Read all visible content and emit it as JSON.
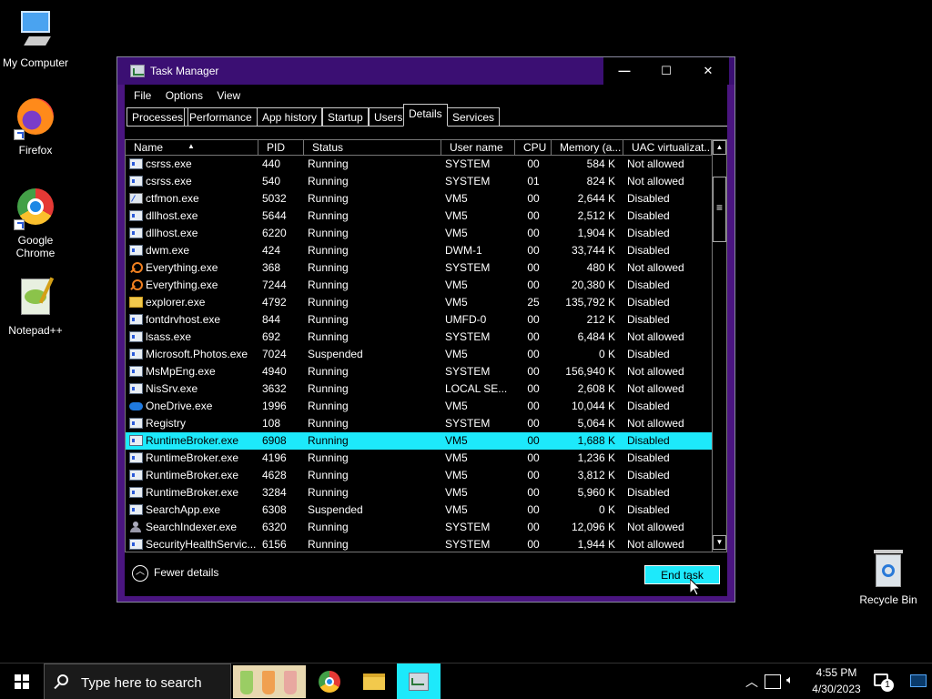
{
  "desktop": {
    "icons": [
      {
        "label": "My Computer"
      },
      {
        "label": "Firefox"
      },
      {
        "label": "Google Chrome"
      },
      {
        "label": "Notepad++"
      }
    ],
    "recycle_bin": "Recycle Bin"
  },
  "window": {
    "title": "Task Manager",
    "controls": {
      "minimize": "—",
      "maximize": "☐",
      "close": "✕"
    },
    "menu": [
      "File",
      "Options",
      "View"
    ],
    "tabs": [
      "Processes",
      "Performance",
      "App history",
      "Startup",
      "Users",
      "Details",
      "Services"
    ],
    "active_tab": "Details",
    "columns": {
      "name": "Name",
      "pid": "PID",
      "status": "Status",
      "user": "User name",
      "cpu": "CPU",
      "memory": "Memory (a...",
      "uac": "UAC virtualizat..."
    },
    "rows": [
      {
        "icon": "process-icon",
        "name": "csrss.exe",
        "pid": "440",
        "status": "Running",
        "user": "SYSTEM",
        "cpu": "00",
        "memory": "584 K",
        "uac": "Not allowed"
      },
      {
        "icon": "process-icon",
        "name": "csrss.exe",
        "pid": "540",
        "status": "Running",
        "user": "SYSTEM",
        "cpu": "01",
        "memory": "824 K",
        "uac": "Not allowed"
      },
      {
        "icon": "notepad-icon",
        "name": "ctfmon.exe",
        "pid": "5032",
        "status": "Running",
        "user": "VM5",
        "cpu": "00",
        "memory": "2,644 K",
        "uac": "Disabled"
      },
      {
        "icon": "process-icon",
        "name": "dllhost.exe",
        "pid": "5644",
        "status": "Running",
        "user": "VM5",
        "cpu": "00",
        "memory": "2,512 K",
        "uac": "Disabled"
      },
      {
        "icon": "process-icon",
        "name": "dllhost.exe",
        "pid": "6220",
        "status": "Running",
        "user": "VM5",
        "cpu": "00",
        "memory": "1,904 K",
        "uac": "Disabled"
      },
      {
        "icon": "process-icon",
        "name": "dwm.exe",
        "pid": "424",
        "status": "Running",
        "user": "DWM-1",
        "cpu": "00",
        "memory": "33,744 K",
        "uac": "Disabled"
      },
      {
        "icon": "magnifier-icon",
        "name": "Everything.exe",
        "pid": "368",
        "status": "Running",
        "user": "SYSTEM",
        "cpu": "00",
        "memory": "480 K",
        "uac": "Not allowed"
      },
      {
        "icon": "magnifier-icon",
        "name": "Everything.exe",
        "pid": "7244",
        "status": "Running",
        "user": "VM5",
        "cpu": "00",
        "memory": "20,380 K",
        "uac": "Disabled"
      },
      {
        "icon": "folder-icon",
        "name": "explorer.exe",
        "pid": "4792",
        "status": "Running",
        "user": "VM5",
        "cpu": "25",
        "memory": "135,792 K",
        "uac": "Disabled"
      },
      {
        "icon": "process-icon",
        "name": "fontdrvhost.exe",
        "pid": "844",
        "status": "Running",
        "user": "UMFD-0",
        "cpu": "00",
        "memory": "212 K",
        "uac": "Disabled"
      },
      {
        "icon": "process-icon",
        "name": "lsass.exe",
        "pid": "692",
        "status": "Running",
        "user": "SYSTEM",
        "cpu": "00",
        "memory": "6,484 K",
        "uac": "Not allowed"
      },
      {
        "icon": "process-icon",
        "name": "Microsoft.Photos.exe",
        "pid": "7024",
        "status": "Suspended",
        "user": "VM5",
        "cpu": "00",
        "memory": "0 K",
        "uac": "Disabled"
      },
      {
        "icon": "process-icon",
        "name": "MsMpEng.exe",
        "pid": "4940",
        "status": "Running",
        "user": "SYSTEM",
        "cpu": "00",
        "memory": "156,940 K",
        "uac": "Not allowed"
      },
      {
        "icon": "process-icon",
        "name": "NisSrv.exe",
        "pid": "3632",
        "status": "Running",
        "user": "LOCAL SE...",
        "cpu": "00",
        "memory": "2,608 K",
        "uac": "Not allowed"
      },
      {
        "icon": "cloud-icon",
        "name": "OneDrive.exe",
        "pid": "1996",
        "status": "Running",
        "user": "VM5",
        "cpu": "00",
        "memory": "10,044 K",
        "uac": "Disabled"
      },
      {
        "icon": "process-icon",
        "name": "Registry",
        "pid": "108",
        "status": "Running",
        "user": "SYSTEM",
        "cpu": "00",
        "memory": "5,064 K",
        "uac": "Not allowed"
      },
      {
        "icon": "process-icon",
        "name": "RuntimeBroker.exe",
        "pid": "6908",
        "status": "Running",
        "user": "VM5",
        "cpu": "00",
        "memory": "1,688 K",
        "uac": "Disabled",
        "selected": true
      },
      {
        "icon": "process-icon",
        "name": "RuntimeBroker.exe",
        "pid": "4196",
        "status": "Running",
        "user": "VM5",
        "cpu": "00",
        "memory": "1,236 K",
        "uac": "Disabled"
      },
      {
        "icon": "process-icon",
        "name": "RuntimeBroker.exe",
        "pid": "4628",
        "status": "Running",
        "user": "VM5",
        "cpu": "00",
        "memory": "3,812 K",
        "uac": "Disabled"
      },
      {
        "icon": "process-icon",
        "name": "RuntimeBroker.exe",
        "pid": "3284",
        "status": "Running",
        "user": "VM5",
        "cpu": "00",
        "memory": "5,960 K",
        "uac": "Disabled"
      },
      {
        "icon": "process-icon",
        "name": "SearchApp.exe",
        "pid": "6308",
        "status": "Suspended",
        "user": "VM5",
        "cpu": "00",
        "memory": "0 K",
        "uac": "Disabled"
      },
      {
        "icon": "person-icon",
        "name": "SearchIndexer.exe",
        "pid": "6320",
        "status": "Running",
        "user": "SYSTEM",
        "cpu": "00",
        "memory": "12,096 K",
        "uac": "Not allowed"
      },
      {
        "icon": "process-icon",
        "name": "SecurityHealthServic...",
        "pid": "6156",
        "status": "Running",
        "user": "SYSTEM",
        "cpu": "00",
        "memory": "1,944 K",
        "uac": "Not allowed"
      }
    ],
    "fewer_details": "Fewer details",
    "end_task": "End task",
    "accent_color": "#1de9fb",
    "frame_color": "#4a1580"
  },
  "taskbar": {
    "search_placeholder": "Type here to search",
    "time": "4:55 PM",
    "date": "4/30/2023",
    "notification_count": "1"
  }
}
